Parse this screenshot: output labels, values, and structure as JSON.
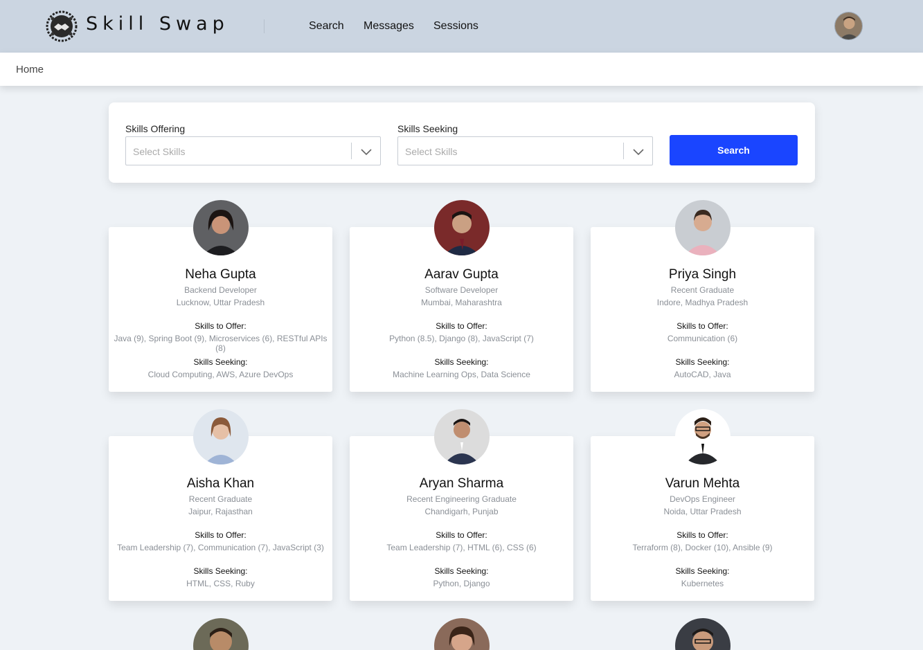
{
  "header": {
    "brand": "Skill Swap",
    "nav": [
      {
        "label": "Search"
      },
      {
        "label": "Messages"
      },
      {
        "label": "Sessions"
      }
    ]
  },
  "breadcrumb": {
    "label": "Home"
  },
  "search": {
    "offering_label": "Skills Offering",
    "offering_placeholder": "Select Skills",
    "seeking_label": "Skills Seeking",
    "seeking_placeholder": "Select Skills",
    "button_label": "Search",
    "button_color": "#1a45ff"
  },
  "card_headings": {
    "offer": "Skills to Offer:",
    "seek": "Skills Seeking:"
  },
  "profiles": [
    {
      "name": "Neha Gupta",
      "role": "Backend Developer",
      "location": "Lucknow, Uttar Pradesh",
      "offer": "Java (9), Spring Boot (9), Microservices (6), RESTful APIs (8)",
      "seek": "Cloud Computing, AWS, Azure DevOps"
    },
    {
      "name": "Aarav Gupta",
      "role": "Software Developer",
      "location": "Mumbai, Maharashtra",
      "offer": "Python (8.5), Django (8), JavaScript (7)",
      "seek": "Machine Learning Ops, Data Science"
    },
    {
      "name": "Priya Singh",
      "role": "Recent Graduate",
      "location": "Indore, Madhya Pradesh",
      "offer": "Communication (6)",
      "seek": "AutoCAD, Java"
    },
    {
      "name": "Aisha Khan",
      "role": "Recent Graduate",
      "location": "Jaipur, Rajasthan",
      "offer": "Team Leadership (7), Communication (7), JavaScript (3)",
      "seek": "HTML, CSS, Ruby"
    },
    {
      "name": "Aryan Sharma",
      "role": "Recent Engineering Graduate",
      "location": "Chandigarh, Punjab",
      "offer": "Team Leadership (7), HTML (6), CSS (6)",
      "seek": "Python, Django"
    },
    {
      "name": "Varun Mehta",
      "role": "DevOps Engineer",
      "location": "Noida, Uttar Pradesh",
      "offer": "Terraform (8), Docker (10), Ansible (9)",
      "seek": "Kubernetes"
    }
  ]
}
